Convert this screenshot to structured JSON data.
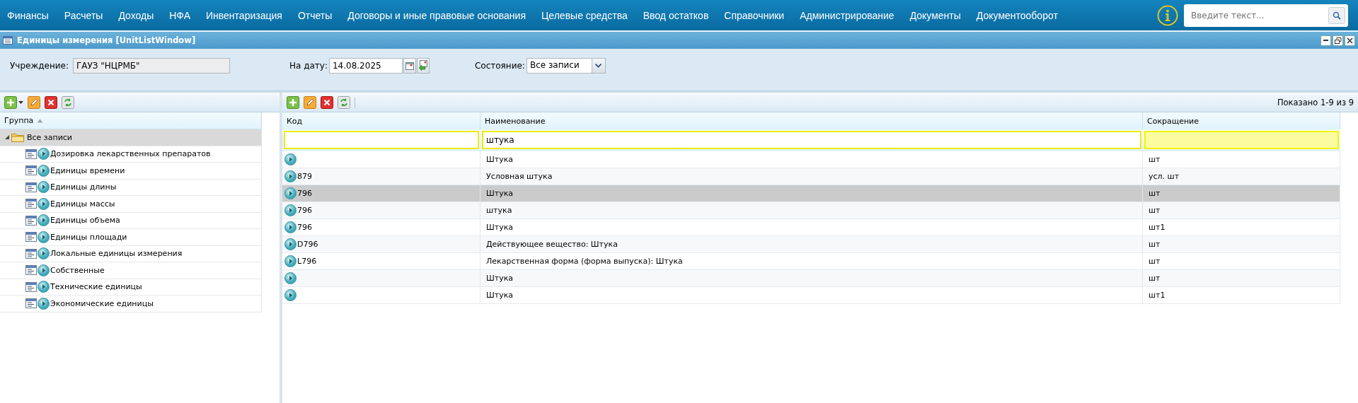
{
  "menu": [
    {
      "label": "Финансы"
    },
    {
      "label": "Расчеты"
    },
    {
      "label": "Доходы"
    },
    {
      "label": "НФА"
    },
    {
      "label": "Инвентаризация"
    },
    {
      "label": "Отчеты"
    },
    {
      "label": "Договоры и иные правовые основания"
    },
    {
      "label": "Целевые средства"
    },
    {
      "label": "Ввод остатков"
    },
    {
      "label": "Справочники"
    },
    {
      "label": "Администрирование"
    },
    {
      "label": "Документы"
    },
    {
      "label": "Документооборот"
    }
  ],
  "search": {
    "placeholder": "Введите текст..."
  },
  "window": {
    "title": "Единицы измерения [UnitListWindow]"
  },
  "filters": {
    "institution_label": "Учреждение:",
    "institution": "ГАУЗ \"НЦРМБ\"",
    "date_label": "На дату:",
    "date": "14.08.2025",
    "state_label": "Состояние:",
    "state": "Все записи"
  },
  "tree": {
    "column": "Группа",
    "sorted": true,
    "root": {
      "label": "Все записи",
      "expanded": true,
      "selected": true,
      "children": [
        {
          "label": "Дозировка лекарственных препаратов",
          "selected": false
        },
        {
          "label": "Единицы времени",
          "selected": false
        },
        {
          "label": "Единицы длины",
          "selected": false
        },
        {
          "label": "Единицы массы",
          "selected": false
        },
        {
          "label": "Единицы объема",
          "selected": false
        },
        {
          "label": "Единицы площади",
          "selected": false
        },
        {
          "label": "Локальные единицы измерения",
          "selected": false
        },
        {
          "label": "Собственные",
          "selected": false
        },
        {
          "label": "Технические единицы",
          "selected": false
        },
        {
          "label": "Экономические единицы",
          "selected": false
        }
      ]
    }
  },
  "grid": {
    "info": "Показано 1-9 из 9",
    "columns": [
      {
        "label": "Код",
        "focused": false
      },
      {
        "label": "Наименование",
        "filter": "штука",
        "focused": false
      },
      {
        "label": "Сокращение",
        "focused": true
      }
    ],
    "rows": [
      {
        "name": "Штука",
        "short": "шт",
        "selected": false
      },
      {
        "code": "879",
        "name": "Условная штука",
        "short": "усл. шт",
        "selected": false
      },
      {
        "code": "796",
        "name": "Штука",
        "short": "шт",
        "selected": true
      },
      {
        "code": "796",
        "name": "штука",
        "short": "шт",
        "selected": false
      },
      {
        "code": "796",
        "name": "Штука",
        "short": "шт1",
        "selected": false
      },
      {
        "code": "D796",
        "name": "Действующее вещество: Штука",
        "short": "шт",
        "selected": false
      },
      {
        "code": "L796",
        "name": "Лекарственная форма (форма выпуска): Штука",
        "short": "шт",
        "selected": false
      },
      {
        "name": "Штука",
        "short": "шт",
        "selected": false
      },
      {
        "name": "Штука",
        "short": "шт1",
        "selected": false
      }
    ]
  }
}
